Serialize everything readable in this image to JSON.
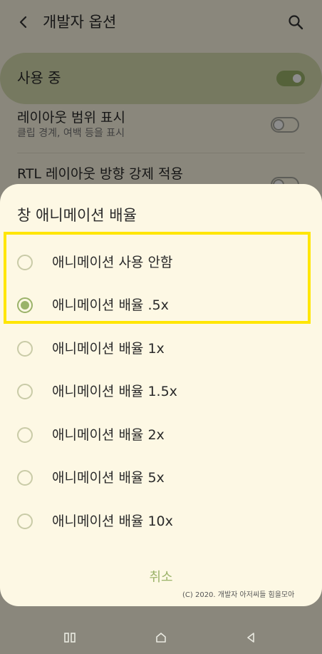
{
  "app_bar": {
    "title": "개발자 옵션"
  },
  "master_switch": {
    "label": "사용 중",
    "enabled": true
  },
  "settings_list": [
    {
      "title": "레이아웃 범위 표시",
      "subtitle": "클립 경계, 여백 등을 표시"
    },
    {
      "title": "RTL 레이아웃 방향 강제 적용"
    }
  ],
  "dialog": {
    "title": "창 애니메이션 배율",
    "options": [
      {
        "label": "애니메이션 사용 안함",
        "selected": false
      },
      {
        "label": "애니메이션 배율 .5x",
        "selected": true
      },
      {
        "label": "애니메이션 배율 1x",
        "selected": false
      },
      {
        "label": "애니메이션 배율 1.5x",
        "selected": false
      },
      {
        "label": "애니메이션 배율 2x",
        "selected": false
      },
      {
        "label": "애니메이션 배율 5x",
        "selected": false
      },
      {
        "label": "애니메이션 배율 10x",
        "selected": false
      }
    ],
    "cancel_label": "취소"
  },
  "credit": "(C) 2020. 개발자 아저씨들 힘을모아",
  "nav_bar": {
    "icons": [
      "recent-apps-icon",
      "home-icon",
      "back-icon"
    ]
  },
  "colors": {
    "accent": "#9bb36a",
    "highlight": "#ffe600",
    "surface": "#fdf8e4"
  }
}
